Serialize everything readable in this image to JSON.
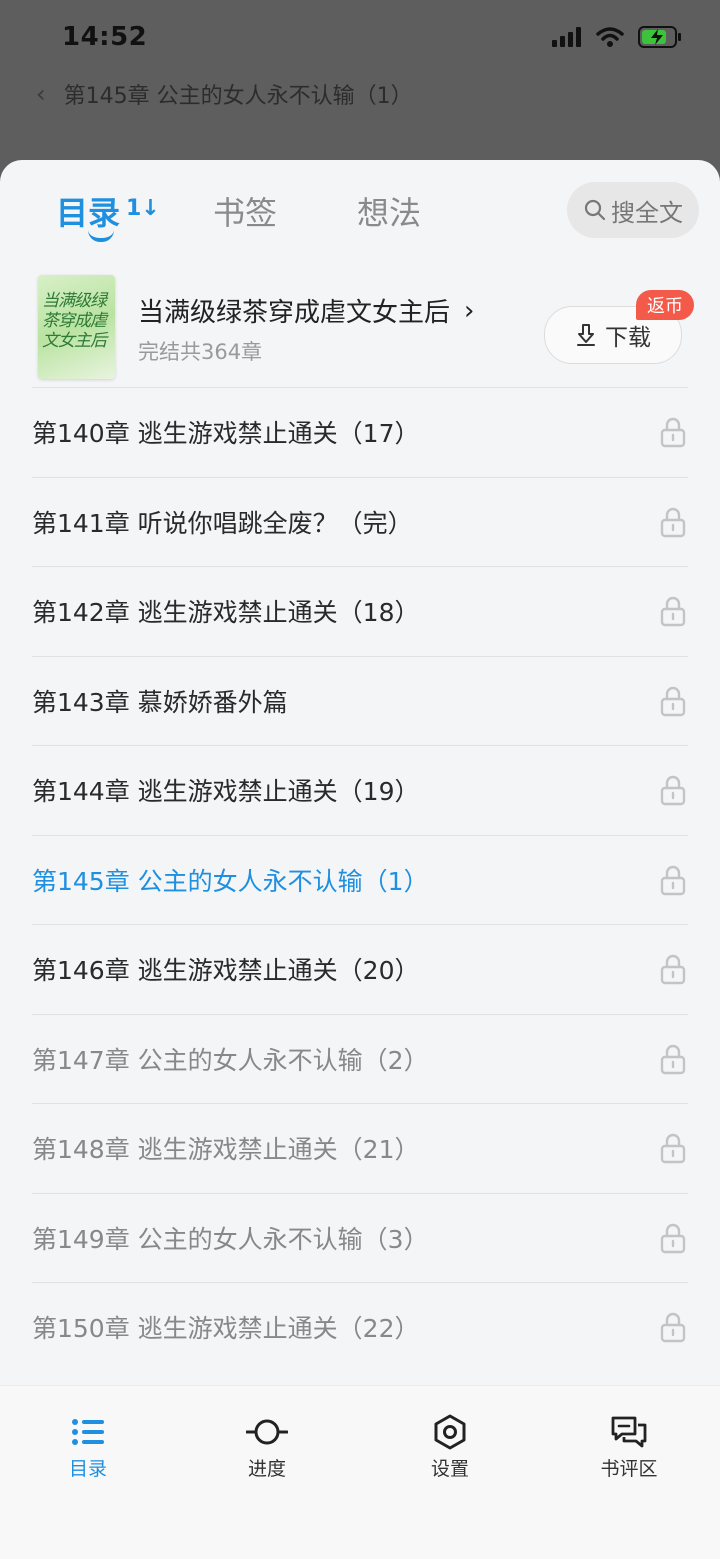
{
  "status": {
    "time": "14:52"
  },
  "reader": {
    "chapter_title": "第145章 公主的女人永不认输（1）"
  },
  "tabs": {
    "toc": "目录",
    "bookmarks": "书签",
    "ideas": "想法",
    "search": "搜全文"
  },
  "book": {
    "title": "当满级绿茶穿成虐文女主后",
    "meta": "完结共364章",
    "cover_text": "当满级绿茶穿成虐文女主后",
    "download_label": "下载",
    "rebate_badge": "返币"
  },
  "chapters": [
    {
      "title": "第140章 逃生游戏禁止通关（17）",
      "state": "normal"
    },
    {
      "title": "第141章 听说你唱跳全废？（完）",
      "state": "normal"
    },
    {
      "title": "第142章 逃生游戏禁止通关（18）",
      "state": "normal"
    },
    {
      "title": "第143章 慕娇娇番外篇",
      "state": "normal"
    },
    {
      "title": "第144章 逃生游戏禁止通关（19）",
      "state": "normal"
    },
    {
      "title": "第145章 公主的女人永不认输（1）",
      "state": "current"
    },
    {
      "title": "第146章 逃生游戏禁止通关（20）",
      "state": "normal"
    },
    {
      "title": "第147章 公主的女人永不认输（2）",
      "state": "dim"
    },
    {
      "title": "第148章 逃生游戏禁止通关（21）",
      "state": "dim"
    },
    {
      "title": "第149章 公主的女人永不认输（3）",
      "state": "dim"
    },
    {
      "title": "第150章 逃生游戏禁止通关（22）",
      "state": "dim"
    }
  ],
  "bottom_nav": {
    "toc": "目录",
    "progress": "进度",
    "settings": "设置",
    "reviews": "书评区"
  },
  "colors": {
    "accent": "#1f8fe0",
    "badge": "#f35a4a"
  }
}
